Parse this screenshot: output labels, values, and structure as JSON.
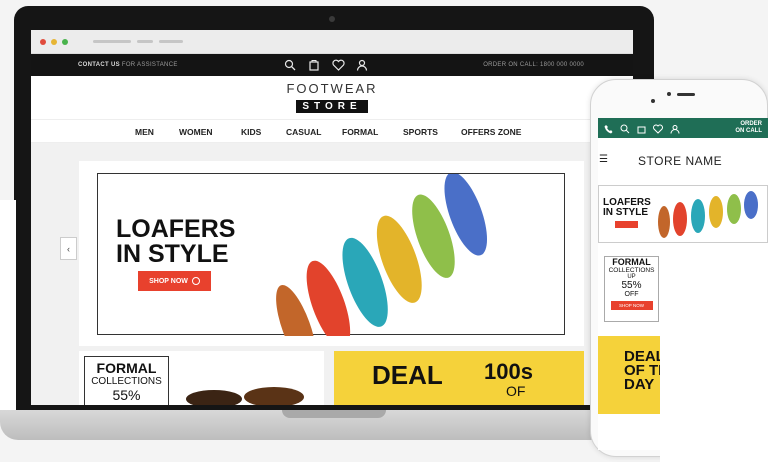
{
  "browser": {
    "colors": {
      "red": "#e04b3c",
      "yellow": "#e6b534",
      "green": "#49b34c"
    }
  },
  "topbar": {
    "contact_label": "CONTACT US",
    "contact_text": "FOR ASSISTANCE",
    "order_text": "ORDER ON CALL: 1800 000 0000"
  },
  "logo": {
    "line1": "FOOTWEAR",
    "line2": "STORE"
  },
  "nav": {
    "items": [
      {
        "label": "MEN"
      },
      {
        "label": "WOMEN"
      },
      {
        "label": "KIDS"
      },
      {
        "label": "CASUAL"
      },
      {
        "label": "FORMAL"
      },
      {
        "label": "SPORTS"
      },
      {
        "label": "OFFERS ZONE"
      }
    ]
  },
  "hero": {
    "line1": "LOAFERS",
    "line2": "IN STYLE",
    "button": "SHOP NOW",
    "arrow": "‹"
  },
  "formal": {
    "title": "FORMAL",
    "subtitle": "COLLECTIONS",
    "percent": "55%"
  },
  "deal": {
    "text1": "DEAL",
    "text2": "100s",
    "text3": "OF"
  },
  "phone": {
    "order": "ORDER\nON CALL",
    "store_name": "STORE NAME",
    "banner_line1": "LOAFERS",
    "banner_line2": "IN STYLE",
    "formal_title": "FORMAL",
    "formal_sub": "COLLECTIONS",
    "formal_up": "UP",
    "formal_percent": "55%",
    "formal_off": "OFF",
    "formal_shop": "SHOP NOW",
    "deal": "DEAL\nOF THE\nDAY"
  },
  "colors": {
    "accent": "#e8412d",
    "deal": "#f5d23a",
    "phone_bar": "#1f6e56"
  }
}
